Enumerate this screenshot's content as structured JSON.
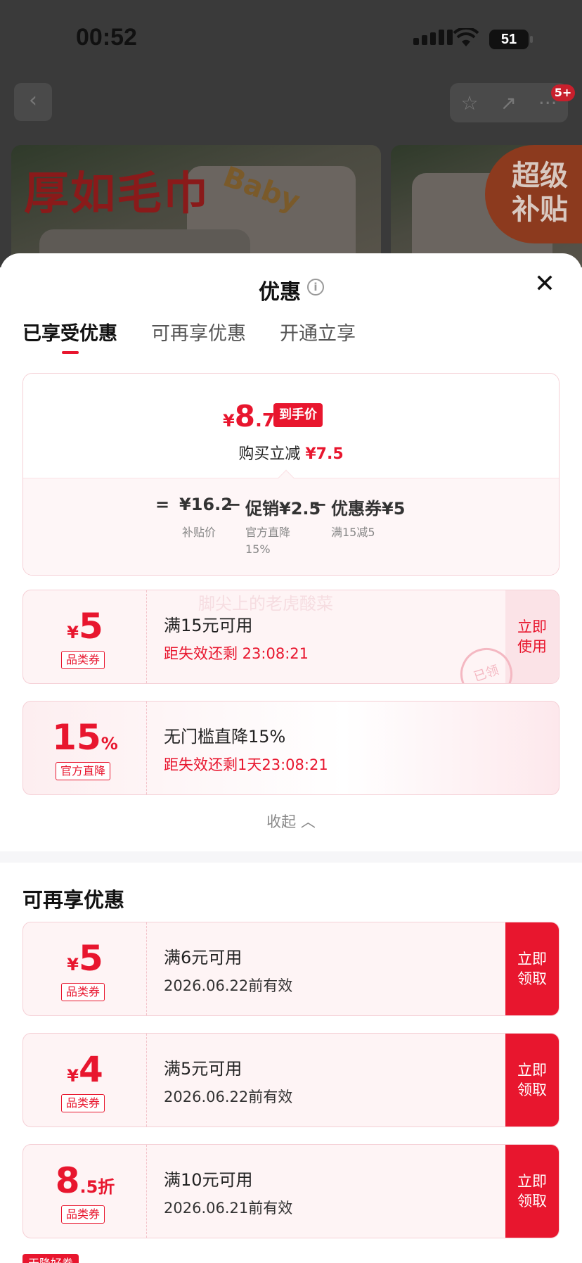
{
  "status": {
    "time": "00:52",
    "battery": "51"
  },
  "nav": {
    "back": "‹",
    "star": "☆",
    "share": "↗",
    "more": "···",
    "badge": "5+"
  },
  "product": {
    "banner_text": "厚如毛巾",
    "brand_text": "Baby",
    "super_badge": "超级\n补贴"
  },
  "sheet": {
    "title": "优惠",
    "info_icon": "i",
    "close": "✕",
    "tabs": [
      {
        "label": "已享受优惠",
        "active": true
      },
      {
        "label": "可再享优惠",
        "active": false
      },
      {
        "label": "开通立享",
        "active": false
      }
    ]
  },
  "summary": {
    "currency": "¥",
    "final_int": "8",
    "final_dec": ".7",
    "final_tag": "到手价",
    "reduce_label": "购买立减",
    "reduce_value": "¥7.5",
    "equals": "=",
    "base_price": "¥16.2",
    "base_label": "补贴价",
    "minus1": "−",
    "promo": "促销¥2.5",
    "promo_label": "官方直降\n15%",
    "minus2": "−",
    "coupon": "优惠券¥5",
    "coupon_label": "满15减5"
  },
  "enjoyed": [
    {
      "sym": "¥",
      "big": "5",
      "suffix": "",
      "type": "品类券",
      "condition": "满15元可用",
      "expire": "距失效还剩 23:08:21",
      "action": "立即\n使用"
    },
    {
      "sym": "",
      "big": "15",
      "suffix": "%",
      "type": "官方直降",
      "condition": "无门槛直降15%",
      "expire": "距失效还剩1天23:08:21",
      "action": ""
    }
  ],
  "stamp": "已领",
  "watermark": "脚尖上的老虎酸菜",
  "collapse": "收起 ︿",
  "more_section": {
    "title": "可再享优惠",
    "items": [
      {
        "sym": "¥",
        "big": "5",
        "suffix": "",
        "type": "品类券",
        "condition": "满6元可用",
        "valid": "2026.06.22前有效",
        "action": "立即\n领取"
      },
      {
        "sym": "¥",
        "big": "4",
        "suffix": "",
        "type": "品类券",
        "condition": "满5元可用",
        "valid": "2026.06.22前有效",
        "action": "立即\n领取"
      },
      {
        "sym": "",
        "big": "8",
        "suffix": ".5折",
        "type": "品类券",
        "condition": "满10元可用",
        "valid": "2026.06.21前有效",
        "action": "立即\n领取"
      }
    ]
  },
  "bottom_tag": "天降好券"
}
